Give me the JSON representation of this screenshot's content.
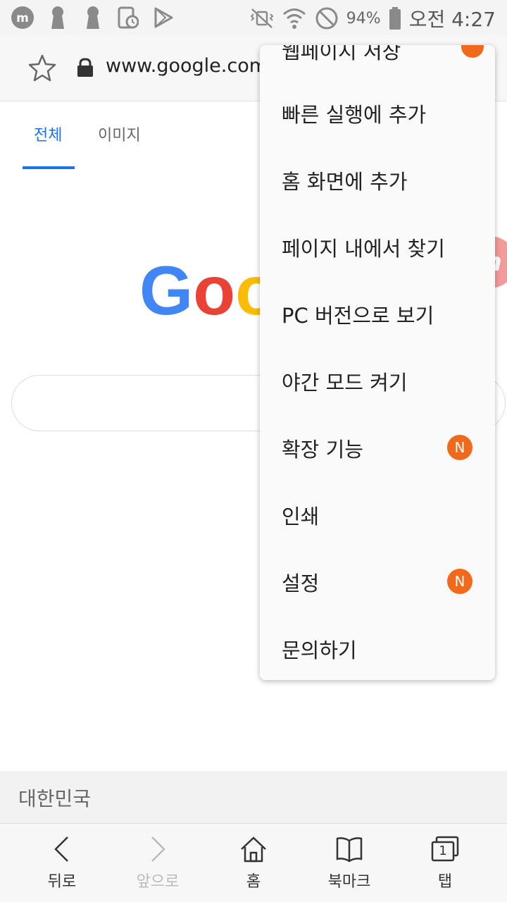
{
  "status_bar": {
    "battery_percent": "94%",
    "time": "오전 4:27",
    "left_icons": [
      "m-app-icon",
      "keyhole-icon",
      "keyhole-icon",
      "screen-clock-icon",
      "play-store-icon"
    ],
    "right_icons": [
      "mute-vibrate-icon",
      "wifi-icon",
      "do-not-disturb-icon",
      "battery-icon"
    ]
  },
  "url_bar": {
    "url": "www.google.com"
  },
  "google_tabs": {
    "all": "전체",
    "images": "이미지"
  },
  "google_logo_text": "Goo",
  "region": {
    "label": "대한민국"
  },
  "bottom_nav": {
    "back": "뒤로",
    "forward": "앞으로",
    "home": "홈",
    "bookmarks": "북마크",
    "tabs": "탭",
    "tab_count": "1"
  },
  "menu": {
    "partial_top": "웹페이지 저장",
    "items": [
      {
        "label": "빠른 실행에 추가",
        "badge": ""
      },
      {
        "label": "홈 화면에 추가",
        "badge": ""
      },
      {
        "label": "페이지 내에서 찾기",
        "badge": ""
      },
      {
        "label": "PC 버전으로 보기",
        "badge": ""
      },
      {
        "label": "야간 모드 켜기",
        "badge": ""
      },
      {
        "label": "확장 기능",
        "badge": "N"
      },
      {
        "label": "인쇄",
        "badge": ""
      },
      {
        "label": "설정",
        "badge": "N"
      },
      {
        "label": "문의하기",
        "badge": ""
      }
    ]
  },
  "colors": {
    "accent": "#1a73e8",
    "badge": "#f16a1c",
    "google_blue": "#4285f4",
    "google_red": "#ea4335",
    "google_yellow": "#fbbc05"
  }
}
